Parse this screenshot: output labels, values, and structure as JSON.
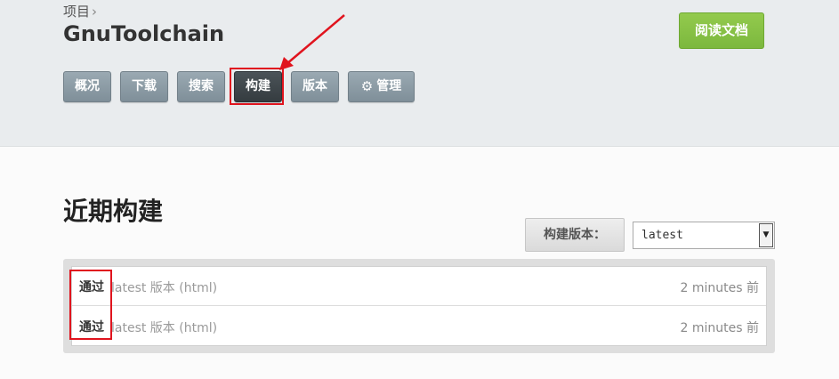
{
  "header": {
    "breadcrumb": "项目",
    "breadcrumb_chevron": "›",
    "project_title": "GnuToolchain",
    "docs_button": "阅读文档"
  },
  "nav": {
    "items": [
      {
        "label": "概况",
        "active": false
      },
      {
        "label": "下载",
        "active": false
      },
      {
        "label": "搜索",
        "active": false
      },
      {
        "label": "构建",
        "active": true
      },
      {
        "label": "版本",
        "active": false
      },
      {
        "label": "管理",
        "active": false,
        "icon": "gear-icon"
      }
    ]
  },
  "main": {
    "section_title": "近期构建",
    "version_label": "构建版本：",
    "version_selected": "latest",
    "builds": [
      {
        "status": "通过",
        "description": "latest 版本 (html)",
        "time": "2 minutes 前"
      },
      {
        "status": "通过",
        "description": "latest 版本 (html)",
        "time": "2 minutes 前"
      }
    ]
  },
  "colors": {
    "docs_button": "#8bc34a",
    "nav_button": "#8a99a3",
    "nav_active": "#3f474c",
    "annotation": "#e0141e"
  }
}
